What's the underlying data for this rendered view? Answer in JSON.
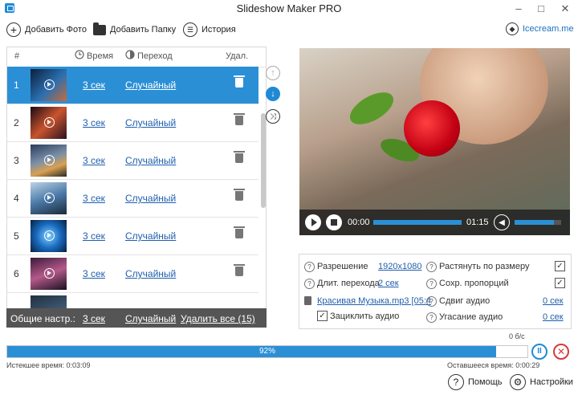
{
  "window": {
    "title": "Slideshow Maker PRO",
    "minimize": "–",
    "maximize": "□",
    "close": "✕"
  },
  "toolbar": {
    "add_photo": "Добавить Фото",
    "add_folder": "Добавить Папку",
    "history": "История",
    "brand": "Icecream.me"
  },
  "table": {
    "col_num": "#",
    "col_time": "Время",
    "col_transition": "Переход",
    "col_delete": "Удал.",
    "rows": [
      {
        "num": "1",
        "time": "3 сек",
        "transition": "Случайный",
        "selected": true
      },
      {
        "num": "2",
        "time": "3 сек",
        "transition": "Случайный"
      },
      {
        "num": "3",
        "time": "3 сек",
        "transition": "Случайный"
      },
      {
        "num": "4",
        "time": "3 сек",
        "transition": "Случайный"
      },
      {
        "num": "5",
        "time": "3 сек",
        "transition": "Случайный"
      },
      {
        "num": "6",
        "time": "3 сек",
        "transition": "Случайный"
      }
    ],
    "footer": {
      "label": "Общие настр.:",
      "time": "3 сек",
      "transition": "Случайный",
      "delete_all": "Удалить все (15)"
    }
  },
  "player": {
    "current_time": "00:00",
    "duration": "01:15",
    "progress": 1.0,
    "volume": 0.85
  },
  "settings": {
    "resolution_label": "Разрешение",
    "resolution_value": "1920x1080",
    "transition_duration_label": "Длит. перехода",
    "transition_duration_value": "2 сек",
    "stretch_label": "Растянуть по размеру",
    "stretch_checked": "✓",
    "keep_ratio_label": "Сохр. пропорций",
    "keep_ratio_checked": "✓",
    "audio_file": "Красивая Музыка.mp3 [05:4",
    "loop_audio_label": "Зациклить аудио",
    "loop_audio_checked": "✓",
    "audio_shift_label": "Сдвиг аудио",
    "audio_shift_value": "0 сек",
    "audio_fade_label": "Угасание аудио",
    "audio_fade_value": "0 сек"
  },
  "progress": {
    "speed": "0 б/с",
    "percent_text": "92%",
    "percent": 0.94,
    "elapsed": "Истекшее время: 0:03:09",
    "remaining": "Оставшееся время: 0:00:29"
  },
  "bottom": {
    "help": "Помощь",
    "settings": "Настройки"
  },
  "colors": {
    "accent": "#2b8fd6",
    "link": "#1f5fae",
    "cancel": "#d63a3a"
  }
}
